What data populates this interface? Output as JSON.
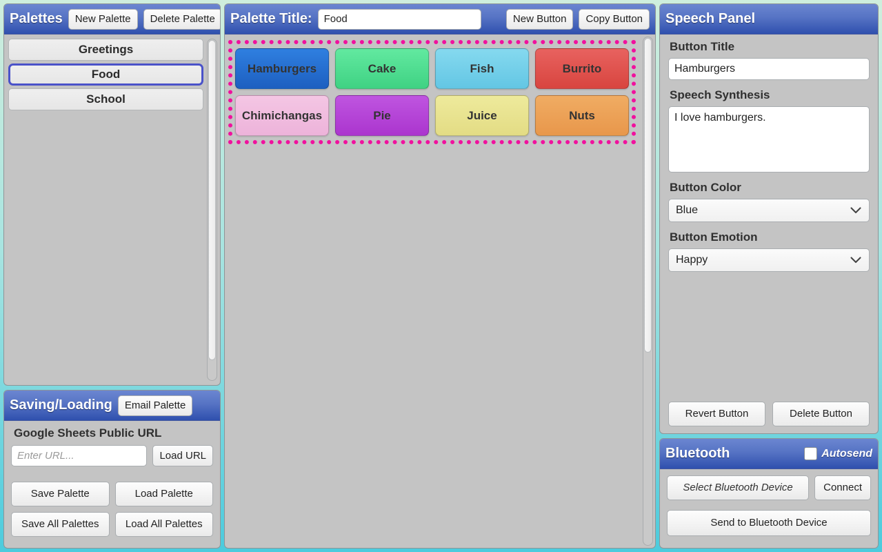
{
  "background": {
    "top_color": "#cfeedd",
    "bottom_color": "#4ccbdd"
  },
  "accent": {
    "header_blue": "#2f50ae",
    "selection_magenta": "#f0119e",
    "selected_item_border": "#4a52c9"
  },
  "palettes_panel": {
    "title": "Palettes",
    "new_palette_label": "New Palette",
    "delete_palette_label": "Delete Palette",
    "items": [
      {
        "label": "Greetings",
        "selected": false
      },
      {
        "label": "Food",
        "selected": true
      },
      {
        "label": "School",
        "selected": false
      }
    ]
  },
  "saving_panel": {
    "title": "Saving/Loading",
    "email_palette_label": "Email Palette",
    "url_field_label": "Google Sheets Public URL",
    "url_value": "",
    "url_placeholder": "Enter URL...",
    "load_url_label": "Load URL",
    "save_palette_label": "Save Palette",
    "load_palette_label": "Load Palette",
    "save_all_label": "Save All Palettes",
    "load_all_label": "Load All Palettes"
  },
  "palette_editor": {
    "title_label": "Palette Title:",
    "title_value": "Food",
    "new_button_label": "New Button",
    "copy_button_label": "Copy Button",
    "selection_active": true,
    "tiles": [
      {
        "label": "Hamburgers",
        "color_top": "#2f7fe0",
        "color_bottom": "#1d5fc0",
        "selected": true
      },
      {
        "label": "Cake",
        "color_top": "#62e9a0",
        "color_bottom": "#3fd283",
        "selected": false
      },
      {
        "label": "Fish",
        "color_top": "#85d9ef",
        "color_bottom": "#63c6e4",
        "selected": false
      },
      {
        "label": "Burrito",
        "color_top": "#e8625f",
        "color_bottom": "#d8453f",
        "selected": false
      },
      {
        "label": "Chimichangas",
        "color_top": "#f4c6e4",
        "color_bottom": "#edb3da",
        "selected": false
      },
      {
        "label": "Pie",
        "color_top": "#bf55e0",
        "color_bottom": "#ab35ce",
        "selected": false
      },
      {
        "label": "Juice",
        "color_top": "#eeea9c",
        "color_bottom": "#e3dc84",
        "selected": false
      },
      {
        "label": "Nuts",
        "color_top": "#f0ac63",
        "color_bottom": "#e8974b",
        "selected": false
      }
    ]
  },
  "speech_panel": {
    "title": "Speech Panel",
    "button_title_label": "Button Title",
    "button_title_value": "Hamburgers",
    "speech_synthesis_label": "Speech Synthesis",
    "speech_synthesis_value": "I love hamburgers.",
    "button_color_label": "Button Color",
    "button_color_value": "Blue",
    "button_emotion_label": "Button Emotion",
    "button_emotion_value": "Happy",
    "revert_button_label": "Revert Button",
    "delete_button_label": "Delete Button"
  },
  "bluetooth_panel": {
    "title": "Bluetooth",
    "autosend_label": "Autosend",
    "autosend_checked": false,
    "select_device_label": "Select Bluetooth Device",
    "connect_label": "Connect",
    "send_label": "Send to Bluetooth Device"
  }
}
